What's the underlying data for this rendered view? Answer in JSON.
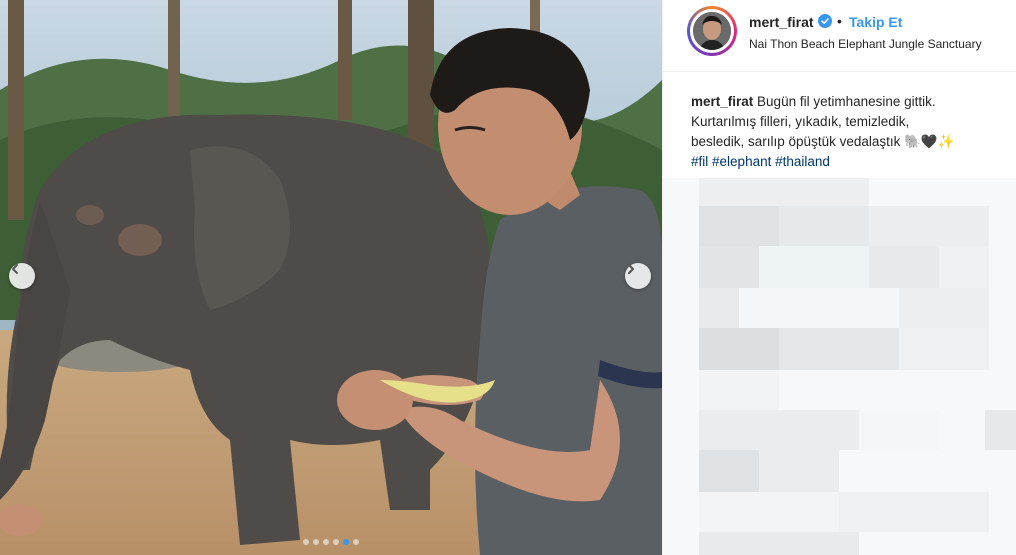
{
  "post": {
    "username": "mert_firat",
    "verified": true,
    "separator": "•",
    "follow_label": "Takip Et",
    "location": "Nai Thon Beach Elephant Jungle Sanctuary"
  },
  "caption": {
    "username": "mert_firat",
    "line1": "Bugün fil yetimhanesine gittik.",
    "line2": "Kurtarılmış filleri, yıkadık, temizledik,",
    "line3": "besledik, sarılıp öpüştük vedalaştık 🐘🖤✨",
    "hashtags": [
      "#fil",
      "#elephant",
      "#thailand"
    ]
  },
  "carousel": {
    "total_slides": 6,
    "active_index": 4
  },
  "icons": {
    "prev": "chevron-left-icon",
    "next": "chevron-right-icon",
    "verified": "verified-badge-icon"
  },
  "colors": {
    "link": "#3897f0",
    "hashtag": "#003569",
    "text": "#262626"
  }
}
